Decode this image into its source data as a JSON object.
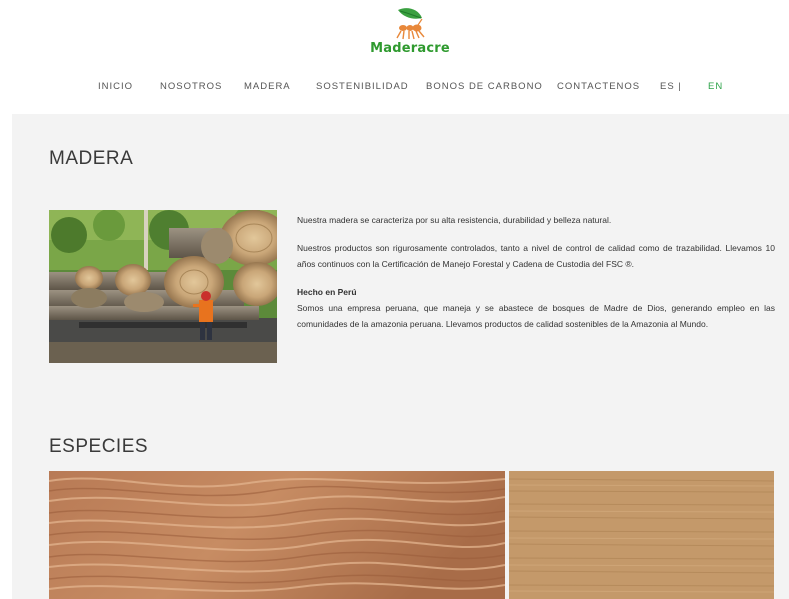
{
  "brand": {
    "name": "Maderacre",
    "color": "#2f9a2f"
  },
  "nav": {
    "items": [
      {
        "label": "INICIO"
      },
      {
        "label": "NOSOTROS"
      },
      {
        "label": "MADERA"
      },
      {
        "label": "SOSTENIBILIDAD"
      },
      {
        "label": "BONOS DE CARBONO"
      },
      {
        "label": "CONTACTENOS"
      },
      {
        "label": "ES |"
      },
      {
        "label": "EN"
      }
    ],
    "active_color": "#2ea34a"
  },
  "madera": {
    "title": "MADERA",
    "paragraphs": [
      "Nuestra madera se caracteriza por su alta resistencia, durabilidad y belleza natural.",
      "Nuestros productos son rigurosamente controlados, tanto a nivel de control de calidad como de trazabilidad. Llevamos 10 años continuos con la Certificación de Manejo Forestal y Cadena de Custodia del FSC ®."
    ],
    "subtitle": "Hecho en Perú",
    "body": "Somos una empresa peruana, que maneja y se abastece de bosques de Madre de Dios, generando empleo en las comunidades de la amazonia peruana. Llevamos productos de calidad sostenibles de la Amazonia al Mundo."
  },
  "especies": {
    "title": "ESPECIES"
  }
}
